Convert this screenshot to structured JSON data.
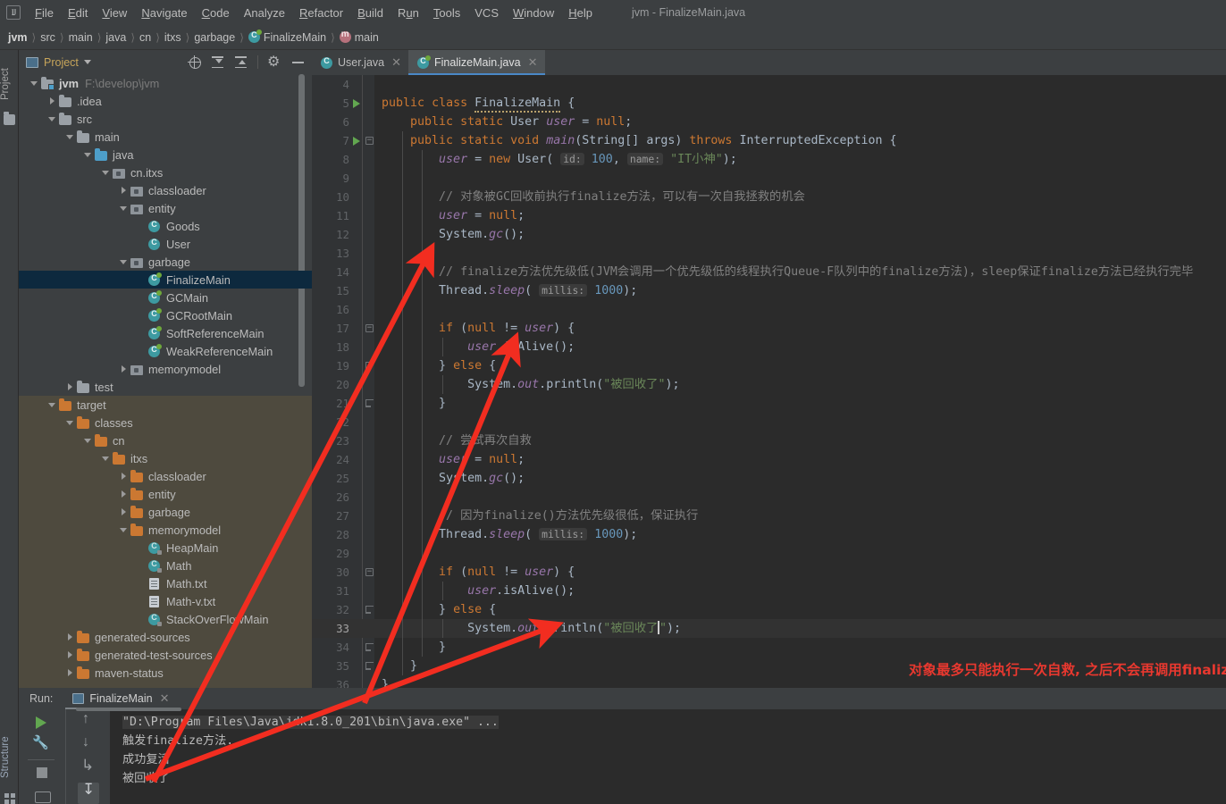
{
  "window": {
    "title": "jvm - FinalizeMain.java"
  },
  "menu": {
    "items": [
      "File",
      "Edit",
      "View",
      "Navigate",
      "Code",
      "Analyze",
      "Refactor",
      "Build",
      "Run",
      "Tools",
      "VCS",
      "Window",
      "Help"
    ]
  },
  "breadcrumb": {
    "items": [
      {
        "label": "jvm",
        "icon": ""
      },
      {
        "label": "src",
        "icon": ""
      },
      {
        "label": "main",
        "icon": ""
      },
      {
        "label": "java",
        "icon": ""
      },
      {
        "label": "cn",
        "icon": ""
      },
      {
        "label": "itxs",
        "icon": ""
      },
      {
        "label": "garbage",
        "icon": ""
      },
      {
        "label": "FinalizeMain",
        "icon": "class-icon"
      },
      {
        "label": "main",
        "icon": "method-icon"
      }
    ]
  },
  "left_strip": {
    "project_label": "Project",
    "structure_label": "Structure"
  },
  "project_panel": {
    "title": "Project",
    "toolbar": [
      "locate-icon",
      "collapse-all-icon",
      "expand-all-icon",
      "settings-gear-icon",
      "hide-icon"
    ],
    "tree": [
      {
        "label": "jvm",
        "path": "F:\\develop\\jvm",
        "icon": "module-folder-icon",
        "arrow": "open",
        "depth": 0,
        "bold": true
      },
      {
        "label": ".idea",
        "icon": "folder-icon",
        "arrow": "closed",
        "depth": 1
      },
      {
        "label": "src",
        "icon": "folder-icon",
        "arrow": "open",
        "depth": 1
      },
      {
        "label": "main",
        "icon": "folder-icon",
        "arrow": "open",
        "depth": 2
      },
      {
        "label": "java",
        "icon": "source-folder-icon",
        "arrow": "open",
        "depth": 3
      },
      {
        "label": "cn.itxs",
        "icon": "package-icon",
        "arrow": "open",
        "depth": 4
      },
      {
        "label": "classloader",
        "icon": "package-icon",
        "arrow": "closed",
        "depth": 5
      },
      {
        "label": "entity",
        "icon": "package-icon",
        "arrow": "open",
        "depth": 5
      },
      {
        "label": "Goods",
        "icon": "class-icon",
        "arrow": "none",
        "depth": 6
      },
      {
        "label": "User",
        "icon": "class-icon",
        "arrow": "none",
        "depth": 6
      },
      {
        "label": "garbage",
        "icon": "package-icon",
        "arrow": "open",
        "depth": 5
      },
      {
        "label": "FinalizeMain",
        "icon": "runnable-class-icon",
        "arrow": "none",
        "depth": 6,
        "selected": true
      },
      {
        "label": "GCMain",
        "icon": "runnable-class-icon",
        "arrow": "none",
        "depth": 6
      },
      {
        "label": "GCRootMain",
        "icon": "runnable-class-icon",
        "arrow": "none",
        "depth": 6
      },
      {
        "label": "SoftReferenceMain",
        "icon": "runnable-class-icon",
        "arrow": "none",
        "depth": 6
      },
      {
        "label": "WeakReferenceMain",
        "icon": "runnable-class-icon",
        "arrow": "none",
        "depth": 6
      },
      {
        "label": "memorymodel",
        "icon": "package-icon",
        "arrow": "closed",
        "depth": 5
      },
      {
        "label": "test",
        "icon": "folder-icon",
        "arrow": "closed",
        "depth": 2
      },
      {
        "label": "target",
        "icon": "excluded-folder-icon",
        "arrow": "open",
        "depth": 1,
        "excluded": true
      },
      {
        "label": "classes",
        "icon": "excluded-folder-icon",
        "arrow": "open",
        "depth": 2,
        "excluded": true
      },
      {
        "label": "cn",
        "icon": "excluded-folder-icon",
        "arrow": "open",
        "depth": 3,
        "excluded": true
      },
      {
        "label": "itxs",
        "icon": "excluded-folder-icon",
        "arrow": "open",
        "depth": 4,
        "excluded": true
      },
      {
        "label": "classloader",
        "icon": "excluded-folder-icon",
        "arrow": "closed",
        "depth": 5,
        "excluded": true
      },
      {
        "label": "entity",
        "icon": "excluded-folder-icon",
        "arrow": "closed",
        "depth": 5,
        "excluded": true
      },
      {
        "label": "garbage",
        "icon": "excluded-folder-icon",
        "arrow": "closed",
        "depth": 5,
        "excluded": true
      },
      {
        "label": "memorymodel",
        "icon": "excluded-folder-icon",
        "arrow": "open",
        "depth": 5,
        "excluded": true
      },
      {
        "label": "HeapMain",
        "icon": "compiled-class-icon",
        "arrow": "none",
        "depth": 6,
        "excluded": true
      },
      {
        "label": "Math",
        "icon": "compiled-class-icon",
        "arrow": "none",
        "depth": 6,
        "excluded": true
      },
      {
        "label": "Math.txt",
        "icon": "text-file-icon",
        "arrow": "none",
        "depth": 6,
        "excluded": true
      },
      {
        "label": "Math-v.txt",
        "icon": "text-file-icon",
        "arrow": "none",
        "depth": 6,
        "excluded": true
      },
      {
        "label": "StackOverFlowMain",
        "icon": "compiled-class-icon",
        "arrow": "none",
        "depth": 6,
        "excluded": true
      },
      {
        "label": "generated-sources",
        "icon": "excluded-folder-icon",
        "arrow": "closed",
        "depth": 2,
        "excluded": true
      },
      {
        "label": "generated-test-sources",
        "icon": "excluded-folder-icon",
        "arrow": "closed",
        "depth": 2,
        "excluded": true
      },
      {
        "label": "maven-status",
        "icon": "excluded-folder-icon",
        "arrow": "closed",
        "depth": 2,
        "excluded": true
      }
    ]
  },
  "editor": {
    "tabs": [
      {
        "label": "User.java",
        "icon": "class-icon",
        "active": false
      },
      {
        "label": "FinalizeMain.java",
        "icon": "runnable-class-icon",
        "active": true
      }
    ],
    "first_line_number": 4,
    "current_line": 33,
    "annotation": "对象最多只能执行一次自救, 之后不会再调用finalize方法.",
    "lines": [
      {
        "n": 4,
        "text": ""
      },
      {
        "n": 5,
        "text": "public class FinalizeMain {",
        "runmark": true
      },
      {
        "n": 6,
        "text": "    public static User user = null;"
      },
      {
        "n": 7,
        "text": "    public static void main(String[] args) throws InterruptedException {",
        "runmark": true,
        "fold": "open"
      },
      {
        "n": 8,
        "text": "        user = new User( id: 100, name: \"IT小神\");"
      },
      {
        "n": 9,
        "text": ""
      },
      {
        "n": 10,
        "text": "        // 对象被GC回收前执行finalize方法，可以有一次自我拯救的机会"
      },
      {
        "n": 11,
        "text": "        user = null;"
      },
      {
        "n": 12,
        "text": "        System.gc();"
      },
      {
        "n": 13,
        "text": ""
      },
      {
        "n": 14,
        "text": "        // finalize方法优先级低(JVM会调用一个优先级低的线程执行Queue-F队列中的finalize方法)，sleep保证finalize方法已经执行完毕"
      },
      {
        "n": 15,
        "text": "        Thread.sleep( millis: 1000);"
      },
      {
        "n": 16,
        "text": ""
      },
      {
        "n": 17,
        "text": "        if (null != user) {",
        "fold": "open"
      },
      {
        "n": 18,
        "text": "            user.isAlive();"
      },
      {
        "n": 19,
        "text": "        } else {",
        "fold": "end"
      },
      {
        "n": 20,
        "text": "            System.out.println(\"被回收了\");"
      },
      {
        "n": 21,
        "text": "        }",
        "fold": "end"
      },
      {
        "n": 22,
        "text": ""
      },
      {
        "n": 23,
        "text": "        // 尝试再次自救"
      },
      {
        "n": 24,
        "text": "        user = null;"
      },
      {
        "n": 25,
        "text": "        System.gc();"
      },
      {
        "n": 26,
        "text": ""
      },
      {
        "n": 27,
        "text": "        // 因为finalize()方法优先级很低，保证执行"
      },
      {
        "n": 28,
        "text": "        Thread.sleep( millis: 1000);"
      },
      {
        "n": 29,
        "text": ""
      },
      {
        "n": 30,
        "text": "        if (null != user) {",
        "fold": "open"
      },
      {
        "n": 31,
        "text": "            user.isAlive();"
      },
      {
        "n": 32,
        "text": "        } else {",
        "fold": "end"
      },
      {
        "n": 33,
        "text": "            System.out.println(\"被回收了\");",
        "current": true
      },
      {
        "n": 34,
        "text": "        }",
        "fold": "end"
      },
      {
        "n": 35,
        "text": "    }",
        "fold": "end"
      },
      {
        "n": 36,
        "text": "}"
      }
    ]
  },
  "run_panel": {
    "label": "Run:",
    "tab_label": "FinalizeMain",
    "toolbar_left": [
      "run-icon",
      "wrench-icon",
      "stop-icon",
      "camera-icon"
    ],
    "toolbar_right": [
      "arrow-up-icon",
      "arrow-down-icon",
      "soft-wrap-icon",
      "scroll-to-end-icon"
    ],
    "console_lines": [
      "\"D:\\Program Files\\Java\\jdk1.8.0_201\\bin\\java.exe\" ...",
      "触发finalize方法...",
      "成功复活",
      "被回收了"
    ]
  },
  "colors": {
    "panel_bg": "#3c3f41",
    "editor_bg": "#2b2b2b",
    "gutter_bg": "#313335",
    "selection_bg": "#0d293e",
    "excluded_bg": "#4e4a3e",
    "accent": "#4a88c7",
    "annotation_red": "#e8382f",
    "keyword": "#cc7832",
    "string": "#6a8759",
    "number": "#6897bb",
    "field": "#9876aa",
    "comment": "#808080",
    "method": "#ffc66d",
    "text": "#a9b7c6"
  }
}
